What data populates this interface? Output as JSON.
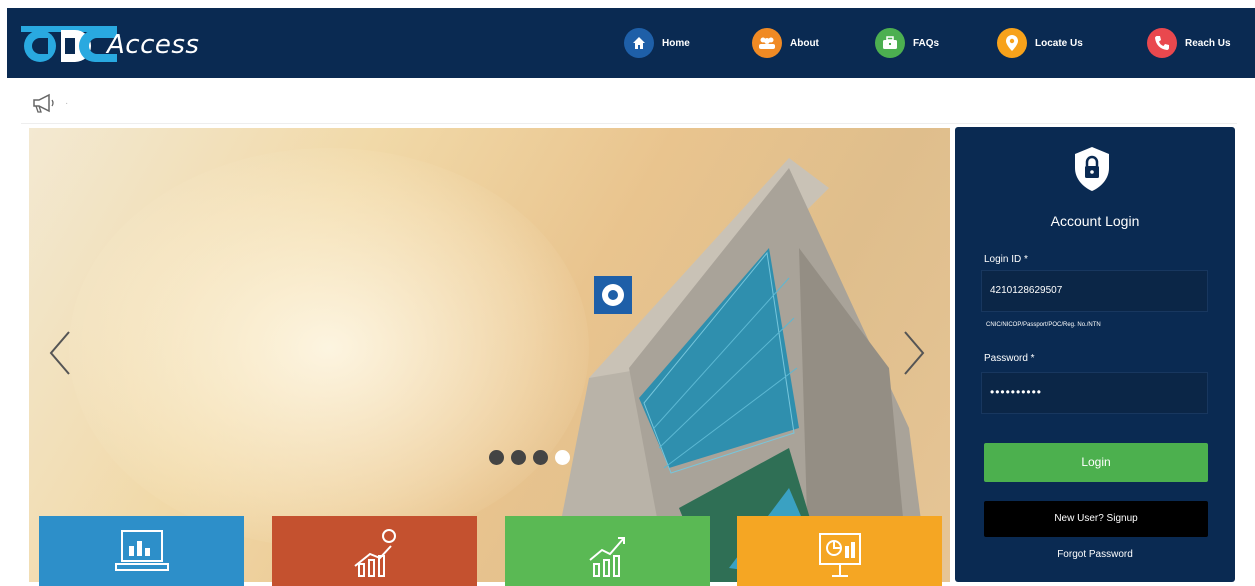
{
  "header": {
    "logo_text": "Access",
    "nav": [
      {
        "label": "Home",
        "icon": "home-icon",
        "color": "#1e5fa8"
      },
      {
        "label": "About",
        "icon": "people-icon",
        "color": "#f08a24"
      },
      {
        "label": "FAQs",
        "icon": "briefcase-icon",
        "color": "#4caf50"
      },
      {
        "label": "Locate Us",
        "icon": "location-pin-icon",
        "color": "#f7a21b"
      },
      {
        "label": "Reach Us",
        "icon": "phone-icon",
        "color": "#e9484e"
      }
    ]
  },
  "ticker": {
    "icon": "megaphone-icon",
    "separator": "·"
  },
  "slider": {
    "slide_count": 4,
    "active_slide": 4,
    "tiles": [
      {
        "icon": "computer-chart-icon",
        "color": "#2d8fc9"
      },
      {
        "icon": "growth-coin-icon",
        "color": "#c4512f"
      },
      {
        "icon": "trend-up-icon",
        "color": "#5ab954"
      },
      {
        "icon": "presentation-chart-icon",
        "color": "#f5a623"
      }
    ]
  },
  "login": {
    "title": "Account Login",
    "login_id_label": "Login ID *",
    "login_id_value": "4210128629507",
    "login_id_hint": "CNIC/NICOP/Passport/POC/Reg. No./NTN",
    "password_label": "Password *",
    "password_value": "••••••••••",
    "login_button": "Login",
    "signup_button": "New User? Signup",
    "forgot_link": "Forgot Password"
  }
}
